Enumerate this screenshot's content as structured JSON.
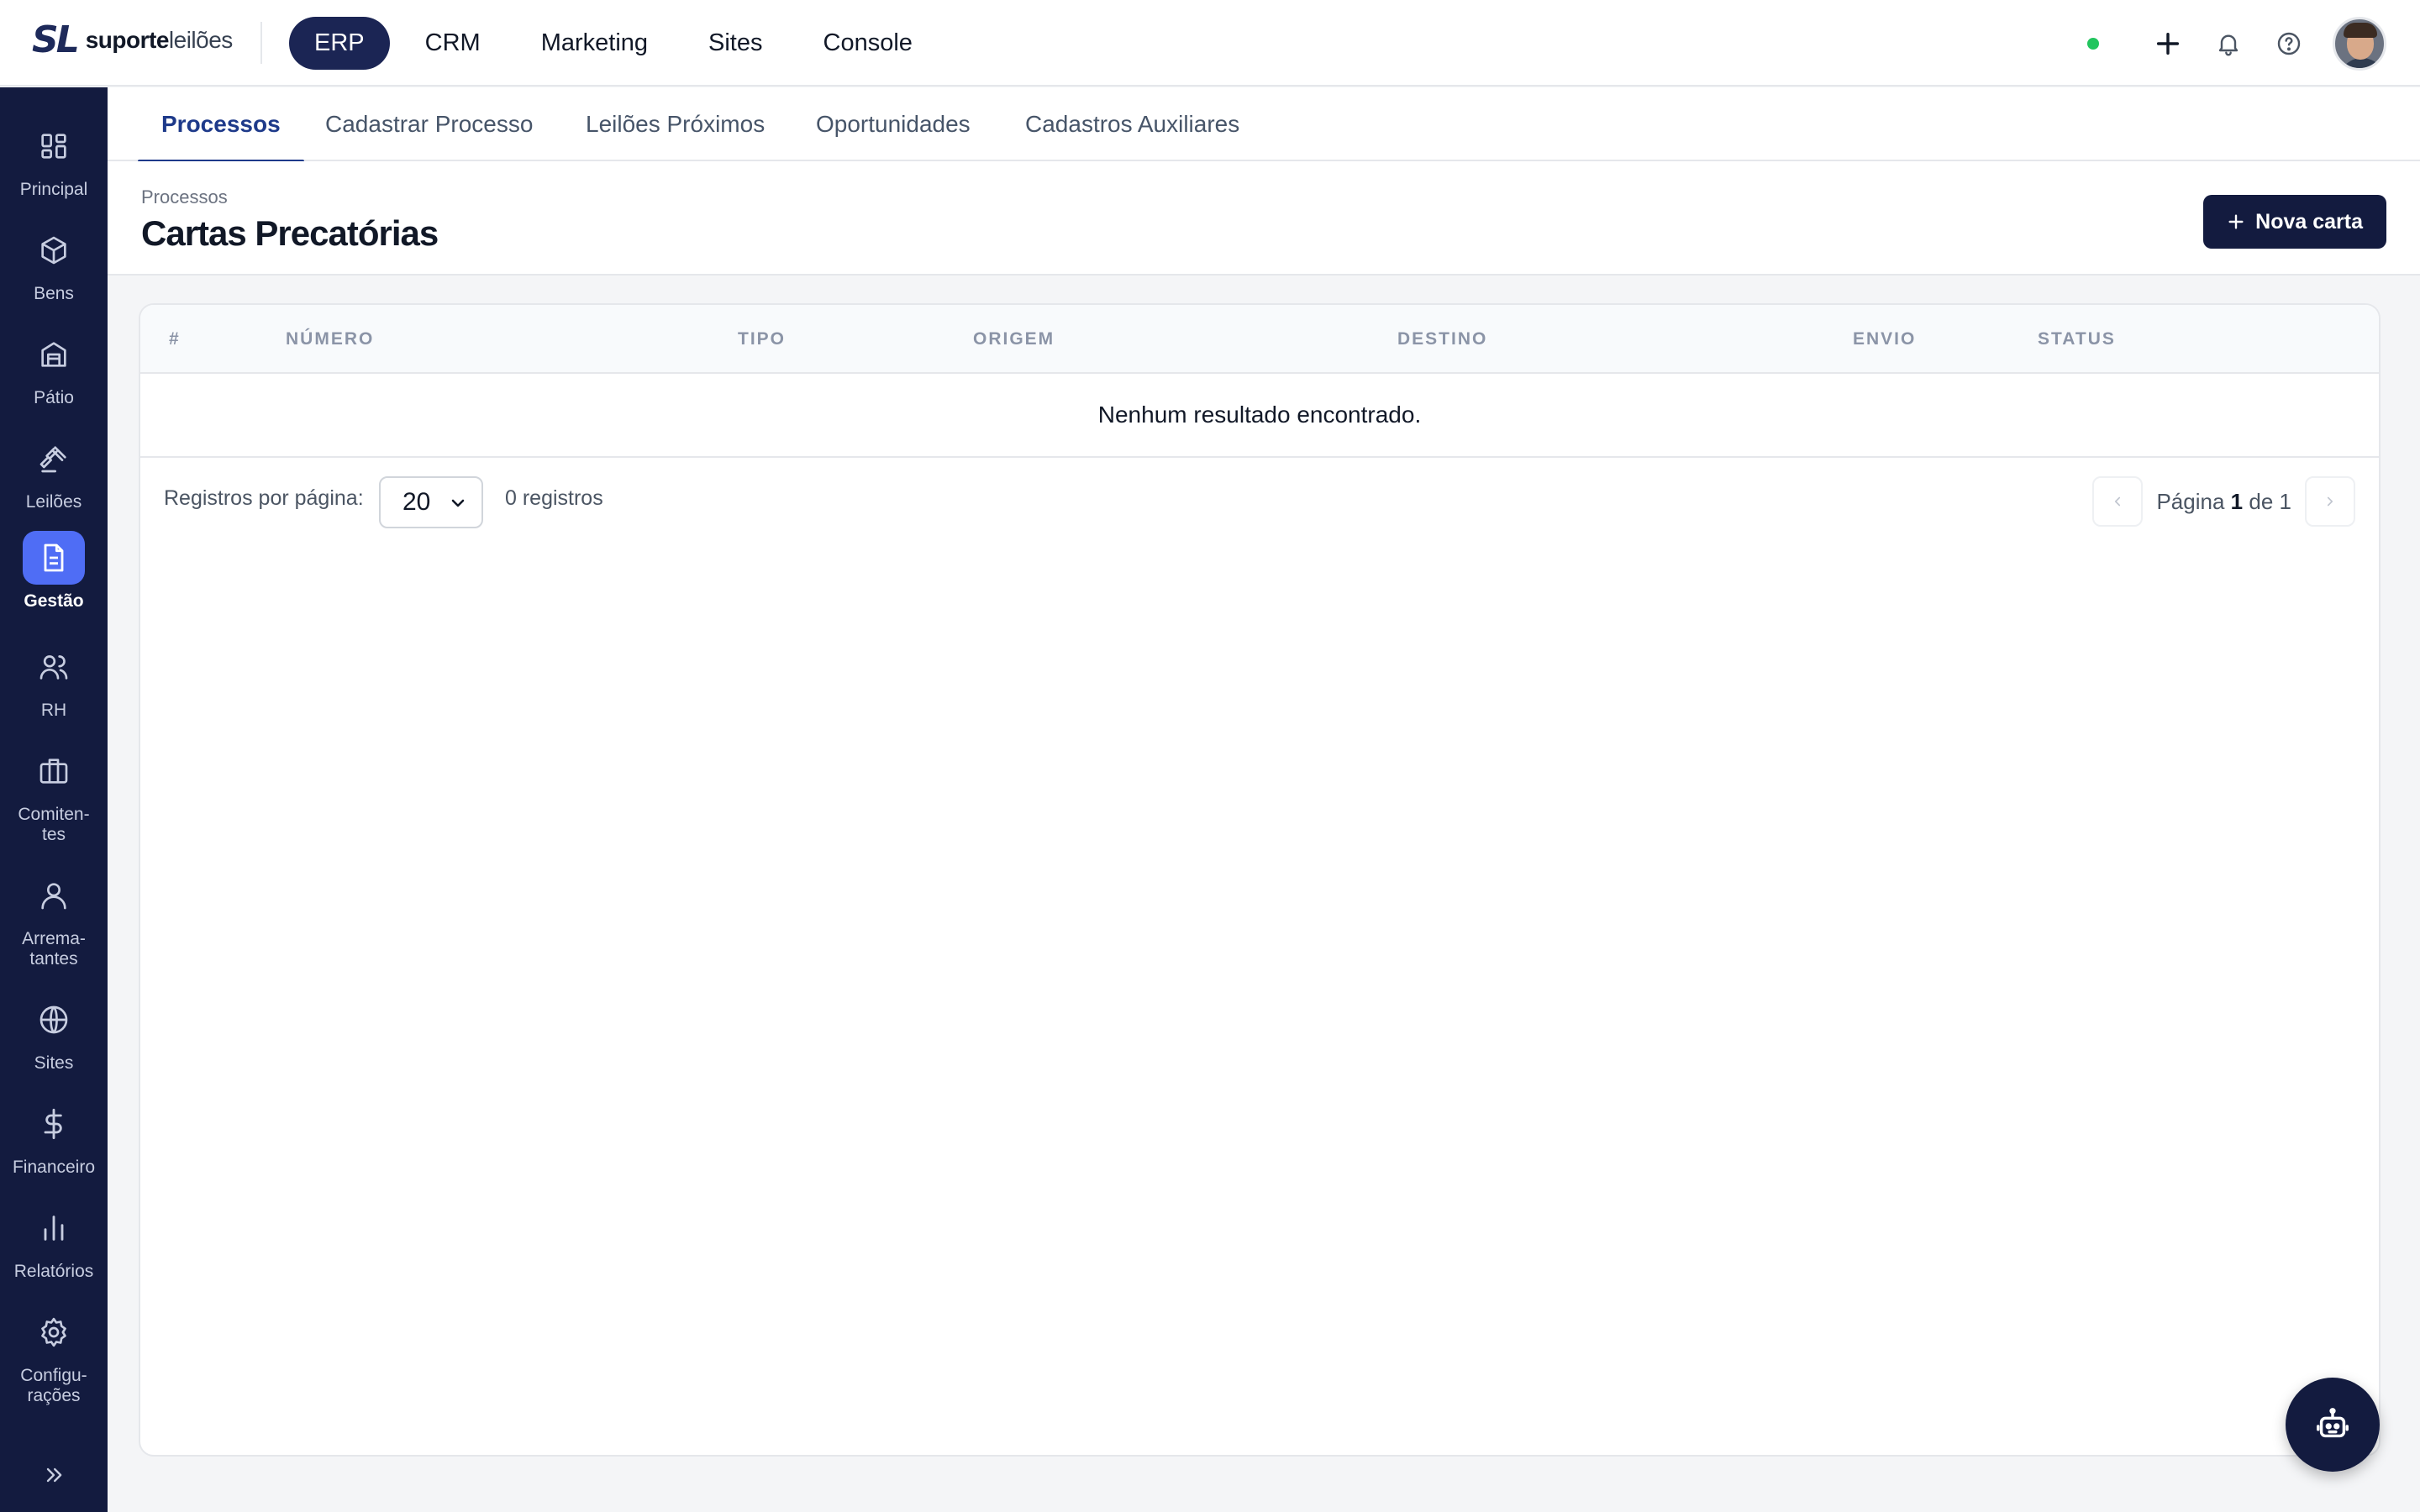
{
  "brand": {
    "mark": "SL",
    "name_bold": "suporte",
    "name_light": "leilões"
  },
  "app_nav": [
    {
      "label": "ERP",
      "active": true
    },
    {
      "label": "CRM",
      "active": false
    },
    {
      "label": "Marketing",
      "active": false
    },
    {
      "label": "Sites",
      "active": false
    },
    {
      "label": "Console",
      "active": false
    }
  ],
  "topright": {
    "status_color": "#22c55e",
    "icons": [
      "plus-icon",
      "bell-icon",
      "help-icon"
    ]
  },
  "sidebar": {
    "items": [
      {
        "label": "Principal",
        "icon": "grid-icon"
      },
      {
        "label": "Bens",
        "icon": "box-icon"
      },
      {
        "label": "Pátio",
        "icon": "warehouse-icon"
      },
      {
        "label": "Leilões",
        "icon": "gavel-icon"
      },
      {
        "label": "Gestão",
        "icon": "document-icon",
        "active": true
      },
      {
        "label": "RH",
        "icon": "users-icon"
      },
      {
        "label": "Comiten-\ntes",
        "icon": "briefcase-icon"
      },
      {
        "label": "Arrema-\ntantes",
        "icon": "user-icon"
      },
      {
        "label": "Sites",
        "icon": "globe-icon"
      },
      {
        "label": "Financeiro",
        "icon": "dollar-icon"
      },
      {
        "label": "Relatórios",
        "icon": "bar-chart-icon"
      },
      {
        "label": "Configu-\nrações",
        "icon": "gear-icon"
      }
    ]
  },
  "tabs": [
    {
      "label": "Processos",
      "active": true
    },
    {
      "label": "Cadastrar Processo"
    },
    {
      "label": "Leilões Próximos"
    },
    {
      "label": "Oportunidades"
    },
    {
      "label": "Cadastros Auxiliares"
    }
  ],
  "page": {
    "breadcrumb": "Processos",
    "title": "Cartas Precatórias",
    "new_button": "Nova carta"
  },
  "table": {
    "columns": [
      "#",
      "NÚMERO",
      "TIPO",
      "ORIGEM",
      "DESTINO",
      "ENVIO",
      "STATUS"
    ],
    "rows": [],
    "empty_message": "Nenhum resultado encontrado."
  },
  "footer": {
    "per_page_label": "Registros por página:",
    "per_page_value": "20",
    "count": "0 registros",
    "page_label": "Página",
    "page_current": "1",
    "page_of": "de",
    "page_total": "1"
  },
  "colors": {
    "accent": "#1b2554",
    "sidebar_bg": "#131b3f",
    "sidebar_active": "#4f6df5",
    "tab_active": "#1e3a8a"
  }
}
